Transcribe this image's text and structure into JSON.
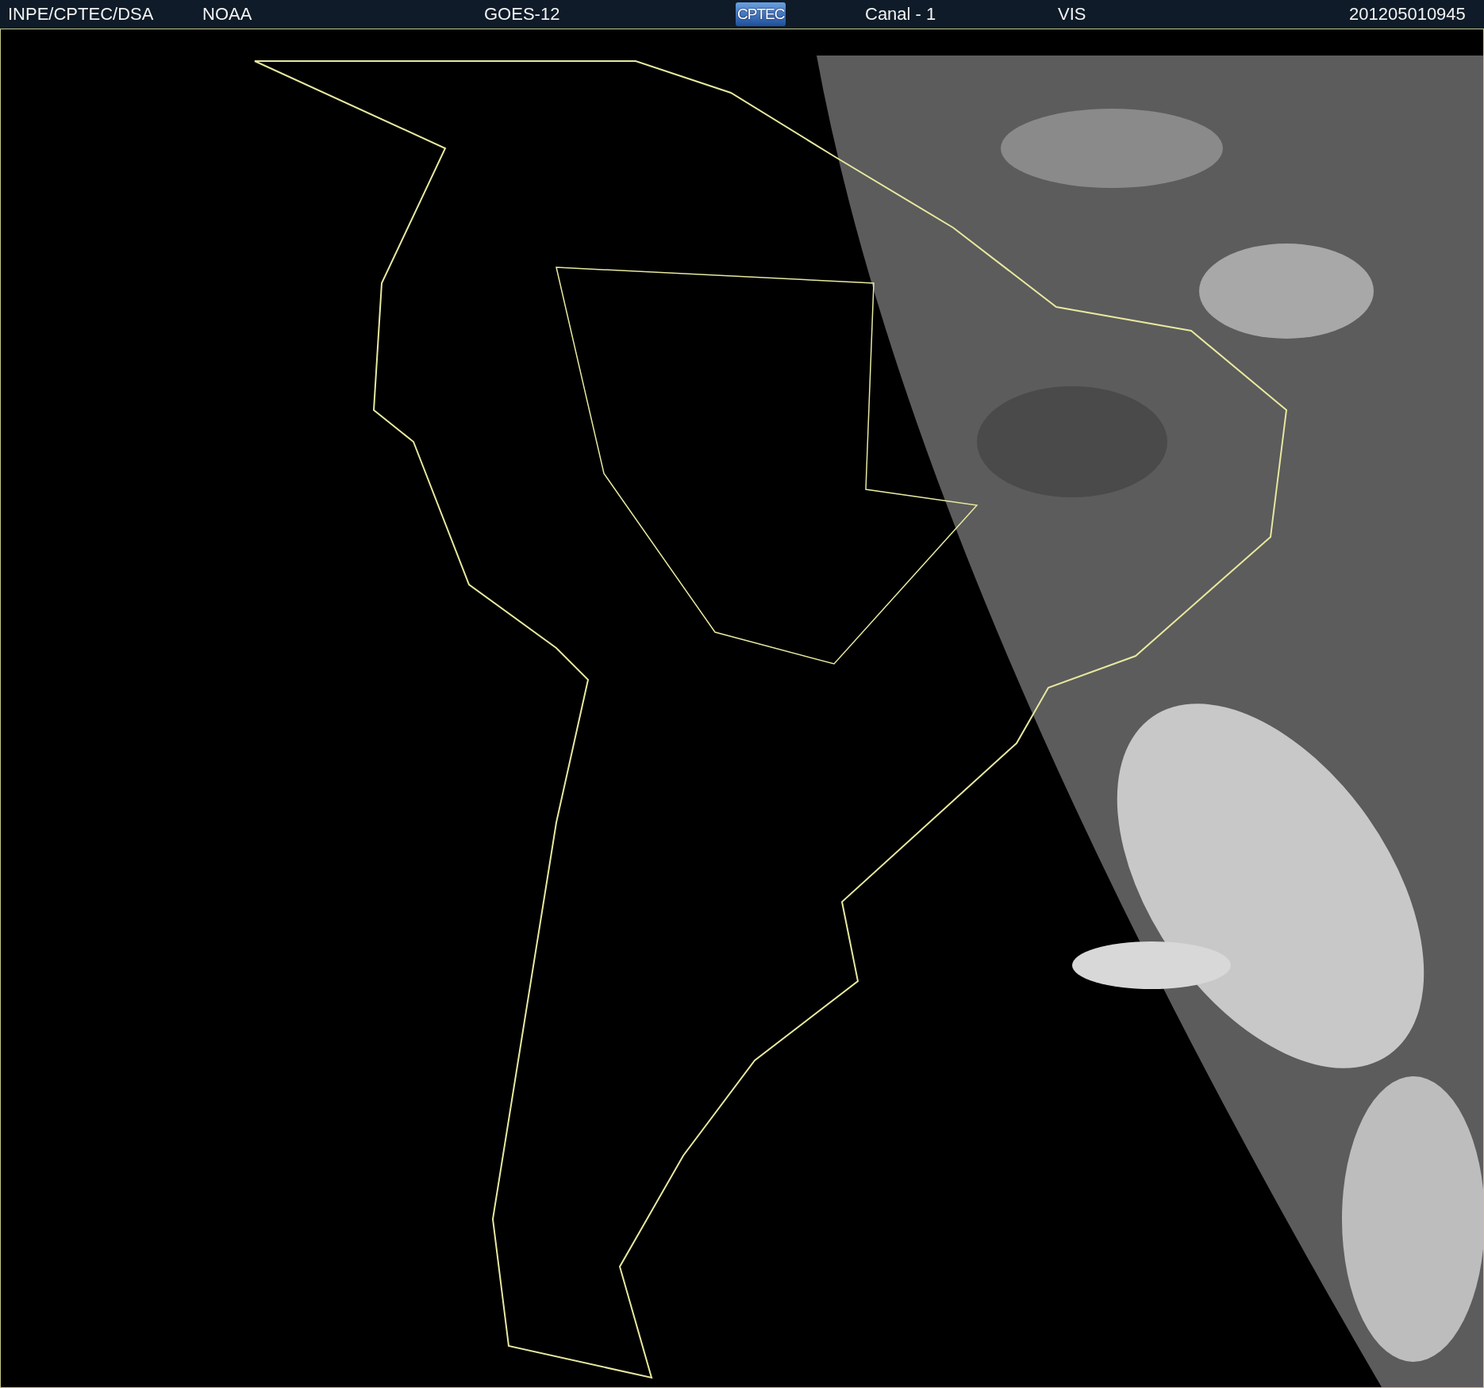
{
  "header": {
    "items": [
      {
        "kind": "text",
        "text": "INPE/CPTEC/DSA"
      },
      {
        "kind": "text",
        "text": "NOAA"
      },
      {
        "kind": "text",
        "text": "GOES-12"
      },
      {
        "kind": "logo",
        "text": "CPTEC"
      },
      {
        "kind": "text",
        "text": "Canal - 1"
      },
      {
        "kind": "text",
        "text": "VIS"
      },
      {
        "kind": "text",
        "text": "201205010945"
      }
    ]
  }
}
